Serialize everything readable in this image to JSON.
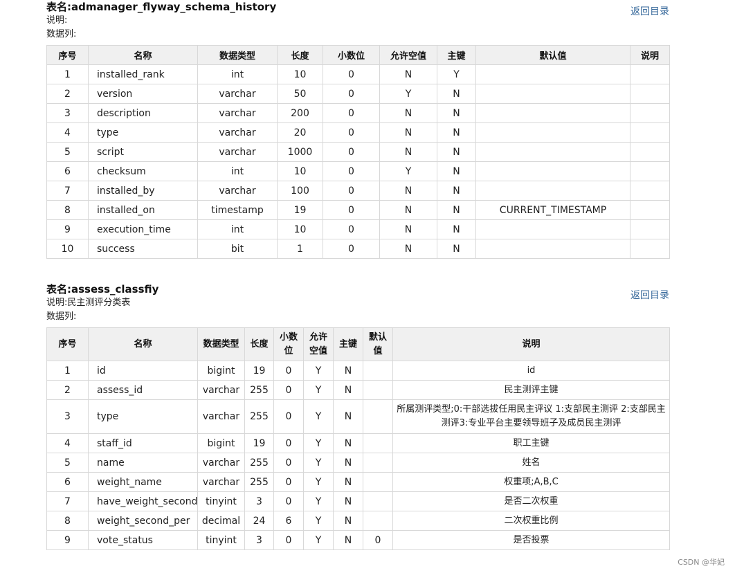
{
  "tables": [
    {
      "title_prefix": "表名:",
      "title": "admanager_flyway_schema_history",
      "desc_label": "说明:",
      "desc": "",
      "cols_label": "数据列:",
      "back_link": "返回目录",
      "headers": [
        "序号",
        "名称",
        "数据类型",
        "长度",
        "小数位",
        "允许空值",
        "主键",
        "默认值",
        "说明"
      ],
      "rows": [
        [
          "1",
          "installed_rank",
          "int",
          "10",
          "0",
          "N",
          "Y",
          "",
          ""
        ],
        [
          "2",
          "version",
          "varchar",
          "50",
          "0",
          "Y",
          "N",
          "",
          ""
        ],
        [
          "3",
          "description",
          "varchar",
          "200",
          "0",
          "N",
          "N",
          "",
          ""
        ],
        [
          "4",
          "type",
          "varchar",
          "20",
          "0",
          "N",
          "N",
          "",
          ""
        ],
        [
          "5",
          "script",
          "varchar",
          "1000",
          "0",
          "N",
          "N",
          "",
          ""
        ],
        [
          "6",
          "checksum",
          "int",
          "10",
          "0",
          "Y",
          "N",
          "",
          ""
        ],
        [
          "7",
          "installed_by",
          "varchar",
          "100",
          "0",
          "N",
          "N",
          "",
          ""
        ],
        [
          "8",
          "installed_on",
          "timestamp",
          "19",
          "0",
          "N",
          "N",
          "CURRENT_TIMESTAMP",
          ""
        ],
        [
          "9",
          "execution_time",
          "int",
          "10",
          "0",
          "N",
          "N",
          "",
          ""
        ],
        [
          "10",
          "success",
          "bit",
          "1",
          "0",
          "N",
          "N",
          "",
          ""
        ]
      ]
    },
    {
      "title_prefix": "表名:",
      "title": "assess_classfiy",
      "desc_label": "说明:",
      "desc": "民主测评分类表",
      "cols_label": "数据列:",
      "back_link": "返回目录",
      "headers": [
        "序号",
        "名称",
        "数据类型",
        "长度",
        "小数位",
        "允许空值",
        "主键",
        "默认值",
        "说明"
      ],
      "rows": [
        [
          "1",
          "id",
          "bigint",
          "19",
          "0",
          "Y",
          "N",
          "",
          "id"
        ],
        [
          "2",
          "assess_id",
          "varchar",
          "255",
          "0",
          "Y",
          "N",
          "",
          "民主测评主键"
        ],
        [
          "3",
          "type",
          "varchar",
          "255",
          "0",
          "Y",
          "N",
          "",
          "所属测评类型;0:干部选拔任用民主评议 1:支部民主测评 2:支部民主测评3:专业平台主要领导班子及成员民主测评"
        ],
        [
          "4",
          "staff_id",
          "bigint",
          "19",
          "0",
          "Y",
          "N",
          "",
          "职工主键"
        ],
        [
          "5",
          "name",
          "varchar",
          "255",
          "0",
          "Y",
          "N",
          "",
          "姓名"
        ],
        [
          "6",
          "weight_name",
          "varchar",
          "255",
          "0",
          "Y",
          "N",
          "",
          "权重项;A,B,C"
        ],
        [
          "7",
          "have_weight_second",
          "tinyint",
          "3",
          "0",
          "Y",
          "N",
          "",
          "是否二次权重"
        ],
        [
          "8",
          "weight_second_per",
          "decimal",
          "24",
          "6",
          "Y",
          "N",
          "",
          "二次权重比例"
        ],
        [
          "9",
          "vote_status",
          "tinyint",
          "3",
          "0",
          "Y",
          "N",
          "0",
          "是否投票"
        ]
      ]
    }
  ],
  "watermark": "CSDN @华妃"
}
